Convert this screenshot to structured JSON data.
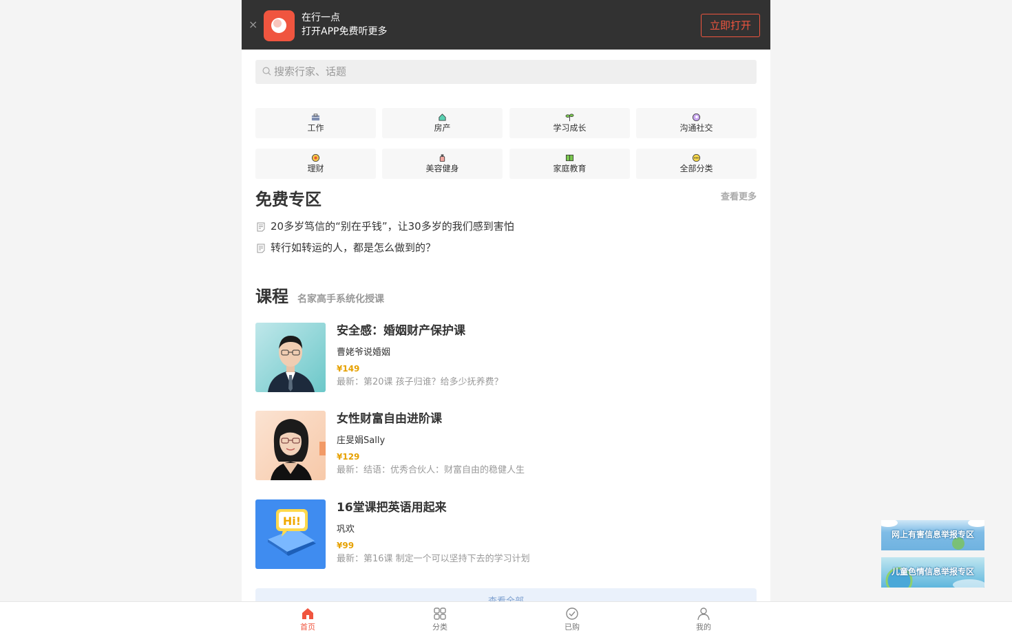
{
  "banner": {
    "app_name": "在行一点",
    "subtitle": "打开APP免费听更多",
    "open_label": "立即打开",
    "close_glyph": "×"
  },
  "search": {
    "placeholder": "搜索行家、话题"
  },
  "categories": [
    {
      "label": "工作",
      "icon": "briefcase-icon"
    },
    {
      "label": "房产",
      "icon": "house-icon"
    },
    {
      "label": "学习成长",
      "icon": "sprout-icon"
    },
    {
      "label": "沟通社交",
      "icon": "chat-icon"
    },
    {
      "label": "理财",
      "icon": "coin-icon"
    },
    {
      "label": "美容健身",
      "icon": "bottle-icon"
    },
    {
      "label": "家庭教育",
      "icon": "book-icon"
    },
    {
      "label": "全部分类",
      "icon": "more-icon"
    }
  ],
  "free_zone": {
    "title": "免费专区",
    "more_label": "查看更多",
    "items": [
      "20多岁笃信的“别在乎钱”，让30多岁的我们感到害怕",
      "转行如转运的人，都是怎么做到的？"
    ]
  },
  "courses": {
    "title": "课程",
    "subtitle": "名家高手系统化授课",
    "items": [
      {
        "title": "安全感：婚姻财产保护课",
        "author": "曹姥爷说婚姻",
        "price": "¥149",
        "latest": "最新：第20课 孩子归谁？给多少抚养费？"
      },
      {
        "title": "女性财富自由进阶课",
        "author": "庄旻娟Sally",
        "price": "¥129",
        "latest": "最新：结语：优秀合伙人：财富自由的稳健人生"
      },
      {
        "title": "16堂课把英语用起来",
        "author": "巩欢",
        "price": "¥99",
        "latest": "最新：第16课 制定一个可以坚持下去的学习计划"
      }
    ],
    "view_all_label": "查看全部",
    "thumb_text": "Hi!"
  },
  "tabbar": {
    "items": [
      {
        "label": "首页",
        "active": true
      },
      {
        "label": "分类",
        "active": false
      },
      {
        "label": "已购",
        "active": false
      },
      {
        "label": "我的",
        "active": false
      }
    ]
  },
  "side_banners": [
    "网上有害信息举报专区",
    "儿童色情信息举报专区"
  ],
  "colors": {
    "accent": "#f0553f",
    "price": "#e6a100",
    "banner_bg": "#323232"
  }
}
